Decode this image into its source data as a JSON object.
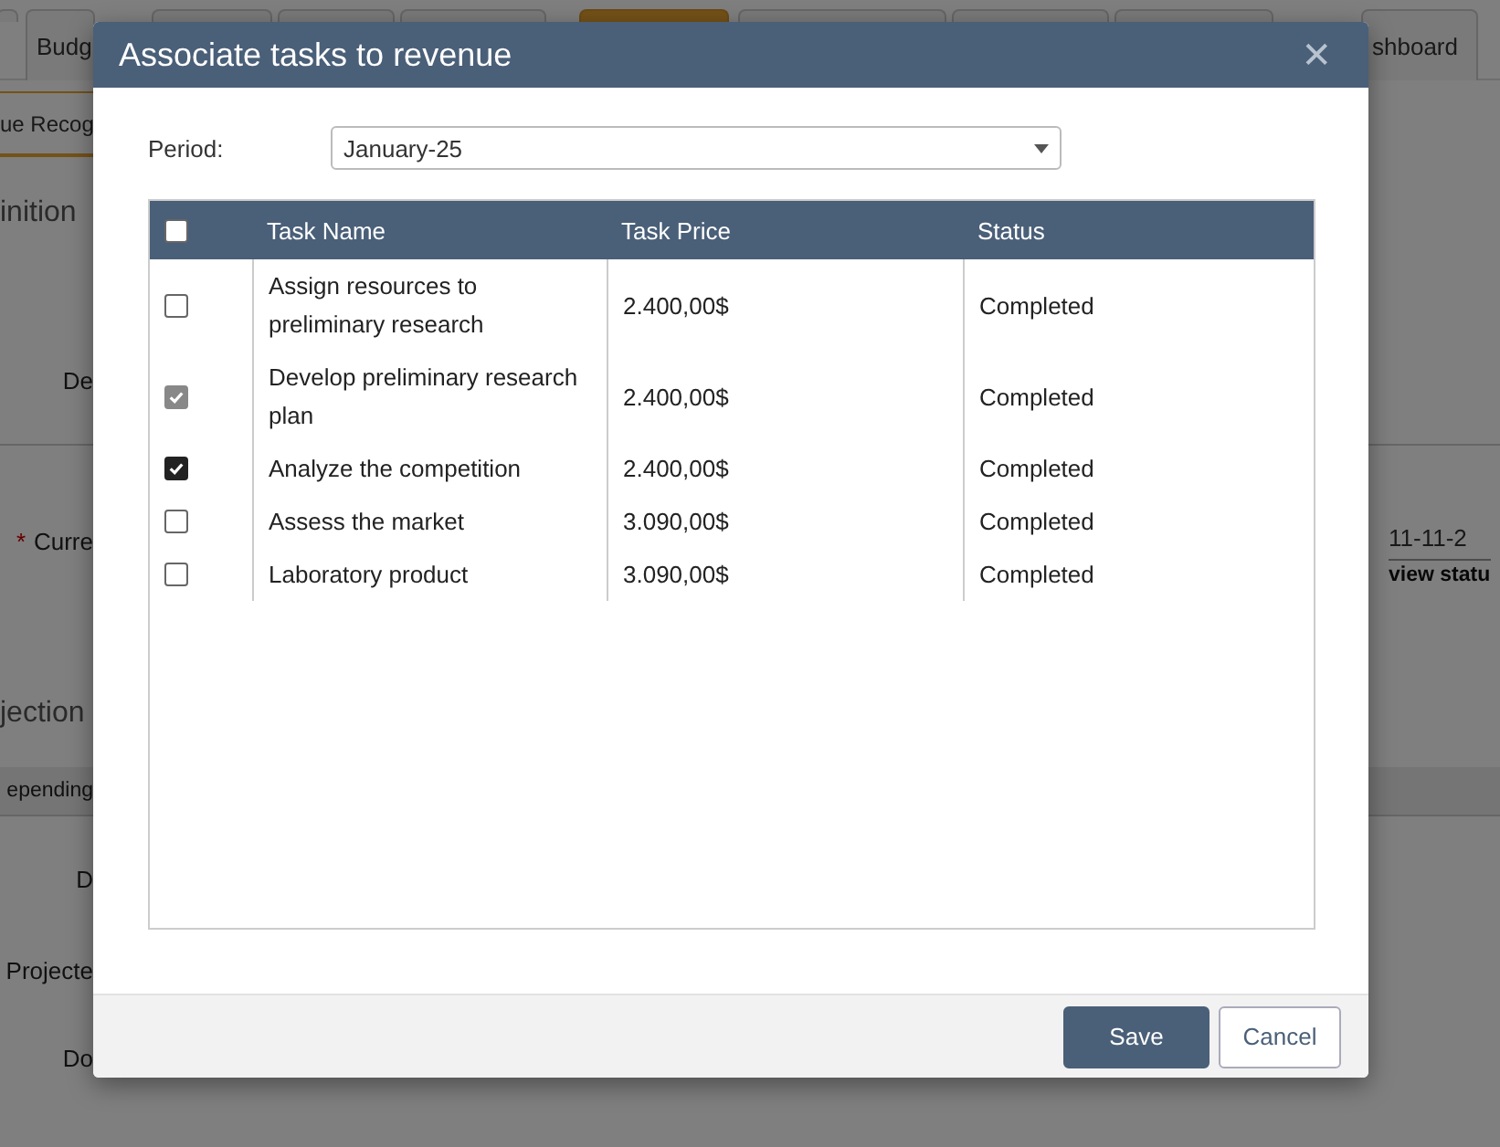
{
  "page": {
    "tabs": [
      {
        "selected": false
      },
      {
        "label": "Budg",
        "selected": false
      },
      {
        "selected": false
      },
      {
        "selected": false
      },
      {
        "selected": false
      },
      {
        "selected": true
      },
      {
        "selected": false
      },
      {
        "selected": false
      },
      {
        "selected": false
      },
      {
        "label": "shboard",
        "selected": false
      }
    ],
    "subtab": {
      "label": "ue Recog",
      "selected": true
    },
    "rows": [
      {
        "kind": "heading",
        "label": "inition"
      },
      {
        "kind": "field",
        "label": "De"
      },
      {
        "kind": "field",
        "label": "Curre",
        "required_mark": "*",
        "value": "11-11-2",
        "link": "view statu"
      },
      {
        "kind": "heading",
        "label": "jection"
      },
      {
        "kind": "band",
        "label": "epending"
      },
      {
        "kind": "field",
        "label": "D"
      },
      {
        "kind": "field",
        "label": "Projecte"
      },
      {
        "kind": "field",
        "label": "Do"
      }
    ]
  },
  "dialog": {
    "title": "Associate tasks to revenue",
    "close": "✕",
    "period": {
      "label": "Period:",
      "value": "January-25"
    },
    "table": {
      "select_all": false,
      "columns": [
        "Task Name",
        "Task Price",
        "Status"
      ],
      "rows": [
        {
          "checked": false,
          "disabled": false,
          "task": "Assign resources to preliminary research",
          "price": "2.400,00$",
          "status": "Completed"
        },
        {
          "checked": true,
          "disabled": true,
          "task": "Develop preliminary research plan",
          "price": "2.400,00$",
          "status": "Completed"
        },
        {
          "checked": true,
          "disabled": false,
          "task": "Analyze the competition",
          "price": "2.400,00$",
          "status": "Completed"
        },
        {
          "checked": false,
          "disabled": false,
          "task": "Assess the market",
          "price": "3.090,00$",
          "status": "Completed"
        },
        {
          "checked": false,
          "disabled": false,
          "task": "Laboratory product",
          "price": "3.090,00$",
          "status": "Completed"
        }
      ]
    },
    "buttons": [
      {
        "kind": "primary",
        "label": "Save"
      },
      {
        "kind": "secondary",
        "label": "Cancel"
      }
    ]
  }
}
